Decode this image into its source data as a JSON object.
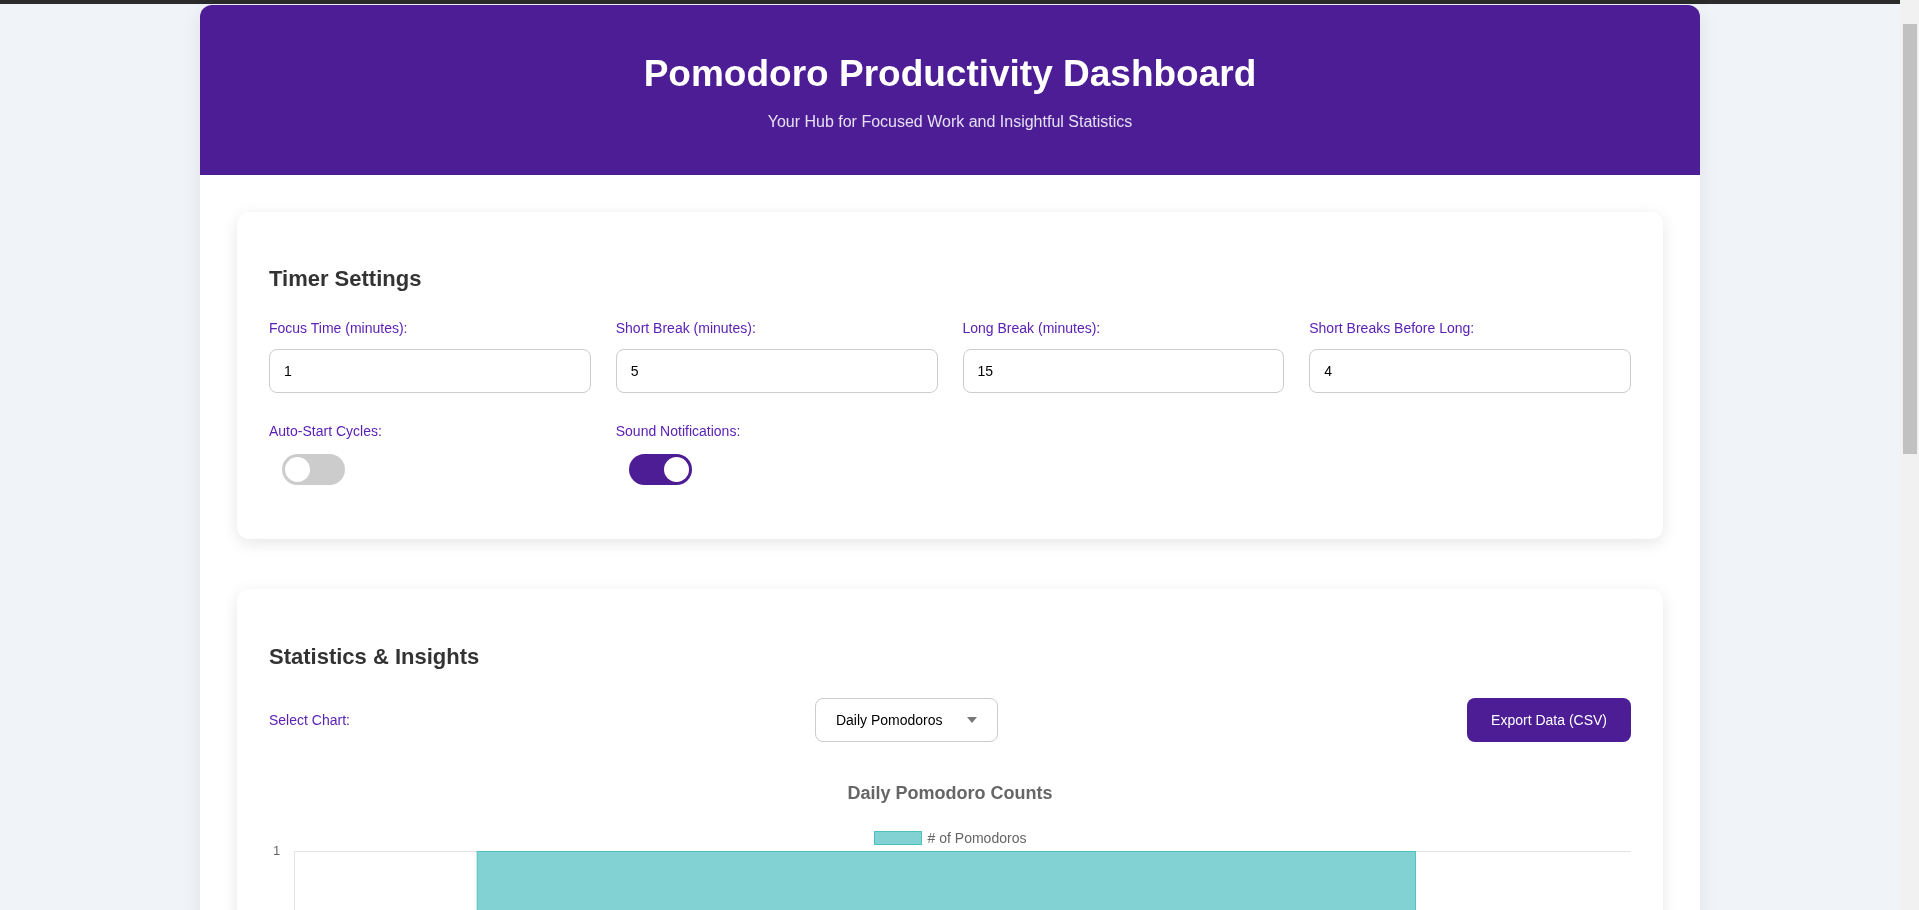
{
  "header": {
    "title": "Pomodoro Productivity Dashboard",
    "subtitle": "Your Hub for Focused Work and Insightful Statistics"
  },
  "timer_settings": {
    "title": "Timer Settings",
    "fields": [
      {
        "label": "Focus Time (minutes):",
        "value": "1"
      },
      {
        "label": "Short Break (minutes):",
        "value": "5"
      },
      {
        "label": "Long Break (minutes):",
        "value": "15"
      },
      {
        "label": "Short Breaks Before Long:",
        "value": "4"
      }
    ],
    "toggles": [
      {
        "label": "Auto-Start Cycles:",
        "on": false
      },
      {
        "label": "Sound Notifications:",
        "on": true
      }
    ]
  },
  "statistics": {
    "title": "Statistics & Insights",
    "select_label": "Select Chart:",
    "select_value": "Daily Pomodoros",
    "export_button": "Export Data (CSV)",
    "chart": {
      "title": "Daily Pomodoro Counts",
      "legend": "# of Pomodoros",
      "y_tick": "1"
    }
  }
}
